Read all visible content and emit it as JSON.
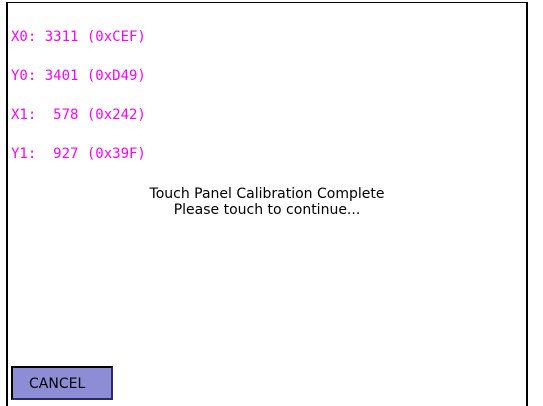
{
  "calibration": {
    "coordinates": [
      "X0: 3311 (0xCEF)",
      "Y0: 3401 (0xD49)",
      "X1:  578 (0x242)",
      "Y1:  927 (0x39F)"
    ],
    "message": {
      "line1": "Touch Panel Calibration Complete",
      "line2": "Please touch to continue..."
    }
  },
  "actions": {
    "cancel_label": "CANCEL"
  },
  "colors": {
    "coordinates_text": "#ff00ff",
    "cancel_button_fill": "#8d8dd6",
    "screen_background": "#ffffff",
    "border": "#000000"
  }
}
